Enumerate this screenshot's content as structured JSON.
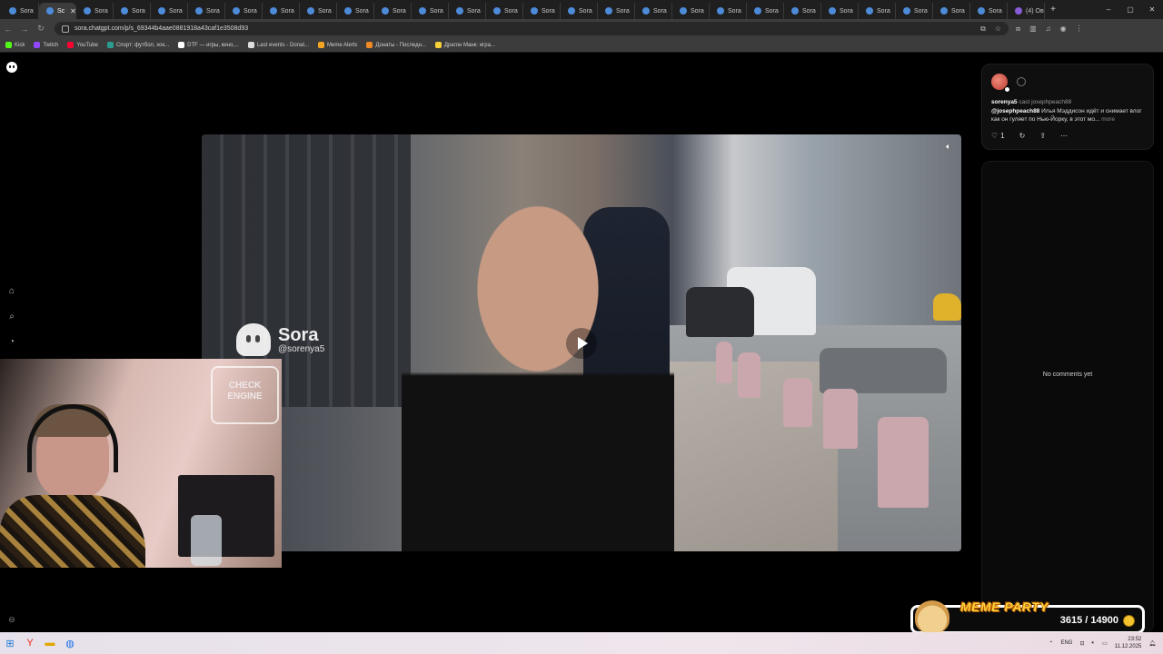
{
  "browser": {
    "tabs": [
      {
        "label": "Sora"
      },
      {
        "label": "Sc",
        "active": true
      },
      {
        "label": "Sora"
      },
      {
        "label": "Sora"
      },
      {
        "label": "Sora"
      },
      {
        "label": "Sora"
      },
      {
        "label": "Sora"
      },
      {
        "label": "Sora"
      },
      {
        "label": "Sora"
      },
      {
        "label": "Sora"
      },
      {
        "label": "Sora"
      },
      {
        "label": "Sora"
      },
      {
        "label": "Sora"
      },
      {
        "label": "Sora"
      },
      {
        "label": "Sora"
      },
      {
        "label": "Sora"
      },
      {
        "label": "Sora"
      },
      {
        "label": "Sora"
      },
      {
        "label": "Sora"
      },
      {
        "label": "Sora"
      },
      {
        "label": "Sora"
      },
      {
        "label": "Sora"
      },
      {
        "label": "Sora"
      },
      {
        "label": "Sora"
      },
      {
        "label": "Sora"
      },
      {
        "label": "Sora"
      },
      {
        "label": "Sora"
      },
      {
        "label": "(4) Ов"
      }
    ],
    "new_tab": "+",
    "window_controls": [
      "–",
      "▢",
      "✕"
    ],
    "url": "sora.chatgpt.com/p/s_69344b4aae0881918a43caf1e3508d93",
    "bookmarks": [
      {
        "label": "Kick",
        "color": "#53fc18"
      },
      {
        "label": "Twitch",
        "color": "#9146ff"
      },
      {
        "label": "YouTube",
        "color": "#ff0033"
      },
      {
        "label": "Спорт: футбол, хок...",
        "color": "#2a9d8f"
      },
      {
        "label": "DTF — игры, кино,...",
        "color": "#ffffff"
      },
      {
        "label": "Last events - Donat...",
        "color": "#dddddd"
      },
      {
        "label": "Meme Alerts",
        "color": "#f4a623"
      },
      {
        "label": "Донаты - Последн...",
        "color": "#f08a24"
      },
      {
        "label": "Драгон Манк: игра...",
        "color": "#f7d13a"
      }
    ]
  },
  "video": {
    "watermark_title": "Sora",
    "watermark_handle": "@sorenya5"
  },
  "webcam": {
    "sign_text": "CHECK ENGINE"
  },
  "post": {
    "username": "sorenya5",
    "cast_label": "cast",
    "cast_user": "josephpeach88",
    "mention": "@josephpeach88",
    "caption": "Илья Мэддисон идёт и снимает влог как он гуляет по Нью-Йорку, в этот мо...",
    "more_label": "more",
    "like_count": "1"
  },
  "comments": {
    "empty_text": "No comments yet"
  },
  "meme_party": {
    "title": "MEME PARTY",
    "count": "3615 / 14900"
  },
  "taskbar": {
    "language": "ENG",
    "time": "23:52",
    "date": "11.12.2025"
  }
}
